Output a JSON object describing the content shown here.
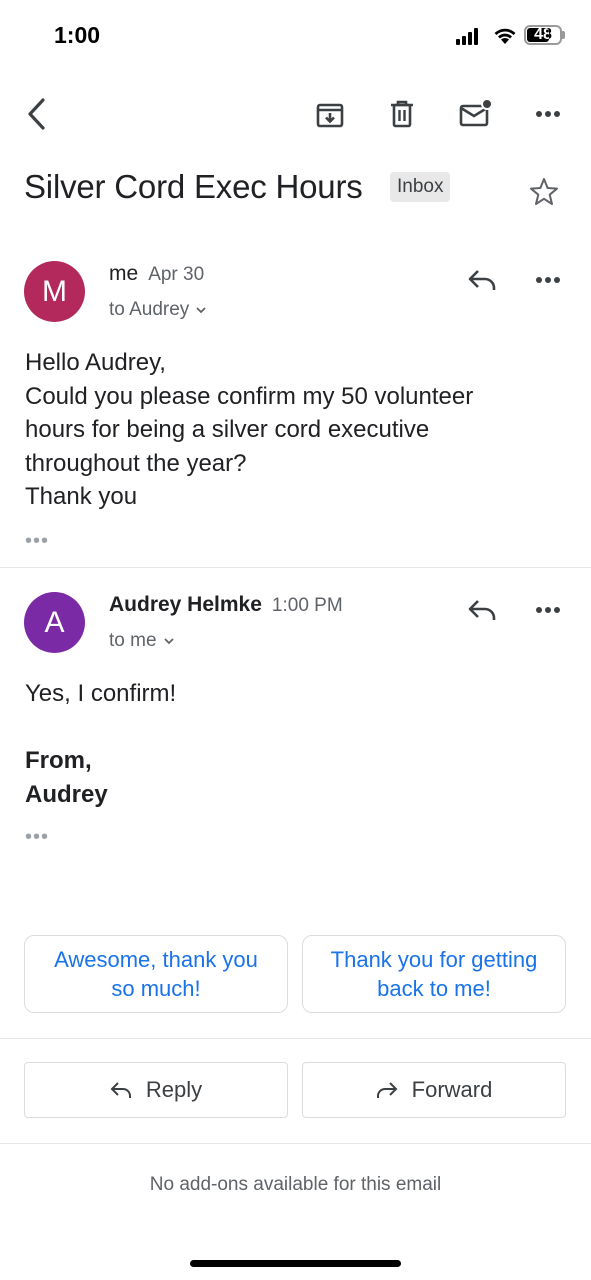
{
  "status_bar": {
    "time": "1:00",
    "battery": "48"
  },
  "toolbar": {
    "icons": [
      "back-arrow-icon",
      "archive-icon",
      "trash-icon",
      "mark-unread-icon",
      "more-icon"
    ]
  },
  "thread": {
    "subject": "Silver Cord Exec Hours",
    "label": "Inbox"
  },
  "messages": [
    {
      "avatar_letter": "M",
      "avatar_color": "#b3295b",
      "sender": "me",
      "date": "Apr 30",
      "recipient": "to Audrey",
      "body_lines": [
        "Hello Audrey,",
        "Could you please confirm my 50 volunteer",
        "hours for being a silver cord executive",
        "throughout the year?",
        "Thank you"
      ],
      "trim": "•••"
    },
    {
      "avatar_letter": "A",
      "avatar_color": "#7b2aa5",
      "sender": "Audrey Helmke",
      "date": "1:00 PM",
      "recipient": "to me",
      "body_line": "Yes, I confirm!",
      "signature_lines": [
        "From,",
        "Audrey"
      ],
      "trim": "•••"
    }
  ],
  "smart_replies": [
    {
      "line1": "Awesome, thank you",
      "line2": "so much!"
    },
    {
      "line1": "Thank you for getting",
      "line2": "back to me!"
    }
  ],
  "actions": {
    "reply": "Reply",
    "forward": "Forward"
  },
  "footer": {
    "addons": "No add-ons available for this email"
  },
  "colors": {
    "link_blue": "#1a73e8",
    "divider": "#e6e6e6"
  }
}
